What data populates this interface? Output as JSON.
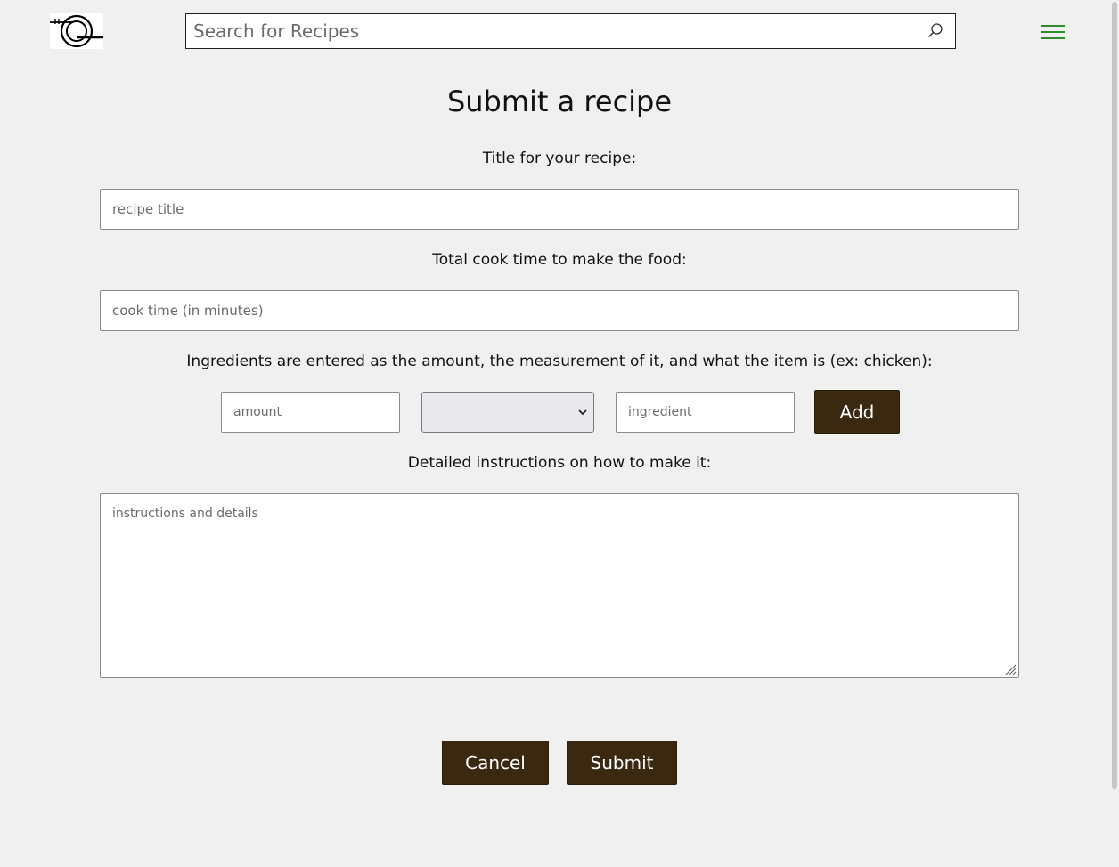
{
  "header": {
    "logo_alt": "logo",
    "search": {
      "placeholder": "Search for Recipes",
      "value": ""
    },
    "icons": {
      "search": "search-icon",
      "menu": "hamburger-menu-icon"
    },
    "accent_color": "#2e8b2e"
  },
  "form": {
    "title": "Submit a recipe",
    "recipe_title_label": "Title for your recipe:",
    "recipe_title_placeholder": "recipe title",
    "cook_time_label": "Total cook time to make the food:",
    "cook_time_placeholder": "cook time (in minutes)",
    "ingredients_label": "Ingredients are entered as the amount, the measurement of it, and what the item is (ex: chicken):",
    "amount_placeholder": "amount",
    "measurement_selected": "",
    "ingredient_placeholder": "ingredient",
    "add_label": "Add",
    "instructions_label": "Detailed instructions on how to make it:",
    "instructions_placeholder": "instructions and details",
    "cancel_label": "Cancel",
    "submit_label": "Submit",
    "button_color": "#3a2910"
  }
}
